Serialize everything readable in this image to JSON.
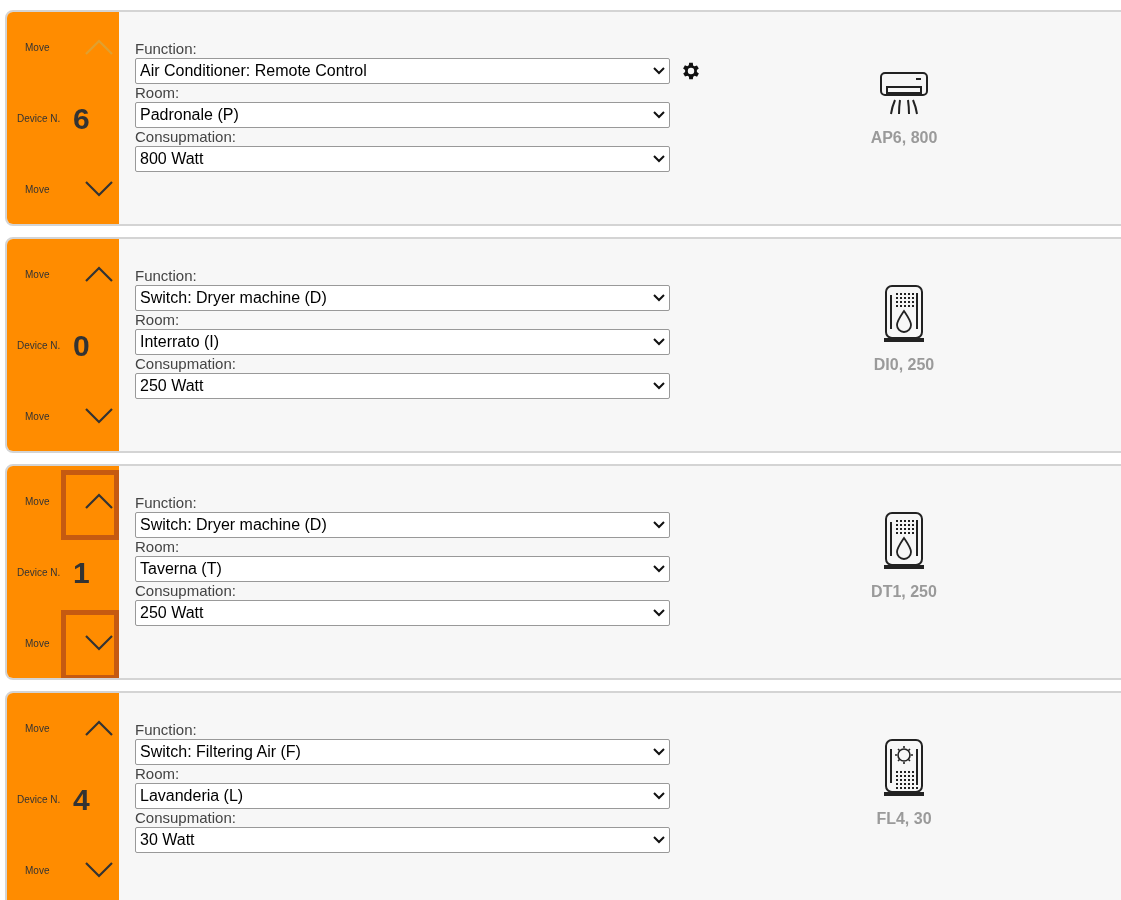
{
  "devices": [
    {
      "move_up": {
        "label": "Move",
        "disabled": true,
        "highlighted": false
      },
      "device_label": "Device N.",
      "number": "6",
      "move_down": {
        "label": "Move",
        "disabled": false,
        "highlighted": false
      },
      "fields": [
        {
          "label": "Function:",
          "value": "Air Conditioner: Remote Control"
        },
        {
          "label": "Room:",
          "value": "Padronale (P)"
        },
        {
          "label": "Consupmation:",
          "value": "800 Watt"
        }
      ],
      "has_settings": true,
      "kind": "air_conditioner",
      "code": "AP6, 800"
    },
    {
      "move_up": {
        "label": "Move",
        "disabled": false,
        "highlighted": false
      },
      "device_label": "Device N.",
      "number": "0",
      "move_down": {
        "label": "Move",
        "disabled": false,
        "highlighted": false
      },
      "fields": [
        {
          "label": "Function:",
          "value": "Switch: Dryer machine (D)"
        },
        {
          "label": "Room:",
          "value": "Interrato (I)"
        },
        {
          "label": "Consupmation:",
          "value": "250 Watt"
        }
      ],
      "has_settings": false,
      "kind": "dehumidifier",
      "code": "DI0, 250"
    },
    {
      "move_up": {
        "label": "Move",
        "disabled": false,
        "highlighted": true
      },
      "device_label": "Device N.",
      "number": "1",
      "move_down": {
        "label": "Move",
        "disabled": false,
        "highlighted": true
      },
      "fields": [
        {
          "label": "Function:",
          "value": "Switch: Dryer machine (D)"
        },
        {
          "label": "Room:",
          "value": "Taverna (T)"
        },
        {
          "label": "Consupmation:",
          "value": "250 Watt"
        }
      ],
      "has_settings": false,
      "kind": "dehumidifier",
      "code": "DT1, 250"
    },
    {
      "move_up": {
        "label": "Move",
        "disabled": false,
        "highlighted": false
      },
      "device_label": "Device N.",
      "number": "4",
      "move_down": {
        "label": "Move",
        "disabled": false,
        "highlighted": false
      },
      "fields": [
        {
          "label": "Function:",
          "value": "Switch: Filtering Air (F)"
        },
        {
          "label": "Room:",
          "value": "Lavanderia (L)"
        },
        {
          "label": "Consupmation:",
          "value": "30 Watt"
        }
      ],
      "has_settings": false,
      "kind": "air_purifier",
      "code": "FL4, 30"
    }
  ]
}
